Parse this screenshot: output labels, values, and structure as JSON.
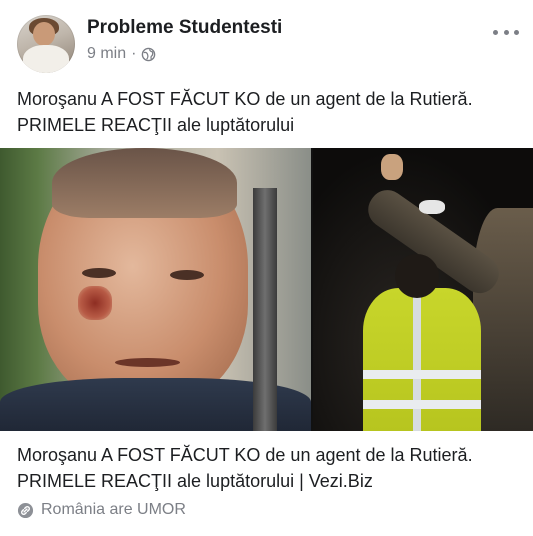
{
  "post": {
    "page_name": "Probleme Studentesti",
    "time": "9 min",
    "separator": "·",
    "privacy_icon": "globe-icon",
    "text": "Moroşanu A FOST FĂCUT KO de un agent de la Rutieră. PRIMELE REACŢII ale luptătorului"
  },
  "link": {
    "title": "Moroşanu A FOST FĂCUT KO de un agent de la Rutieră. PRIMELE REACŢII ale luptătorului | Vezi.Biz",
    "source": "România are UMOR",
    "source_icon": "link-icon"
  },
  "menu": {
    "icon": "more-options-icon"
  },
  "colors": {
    "text": "#1c1e21",
    "secondary": "#7c7f86"
  }
}
